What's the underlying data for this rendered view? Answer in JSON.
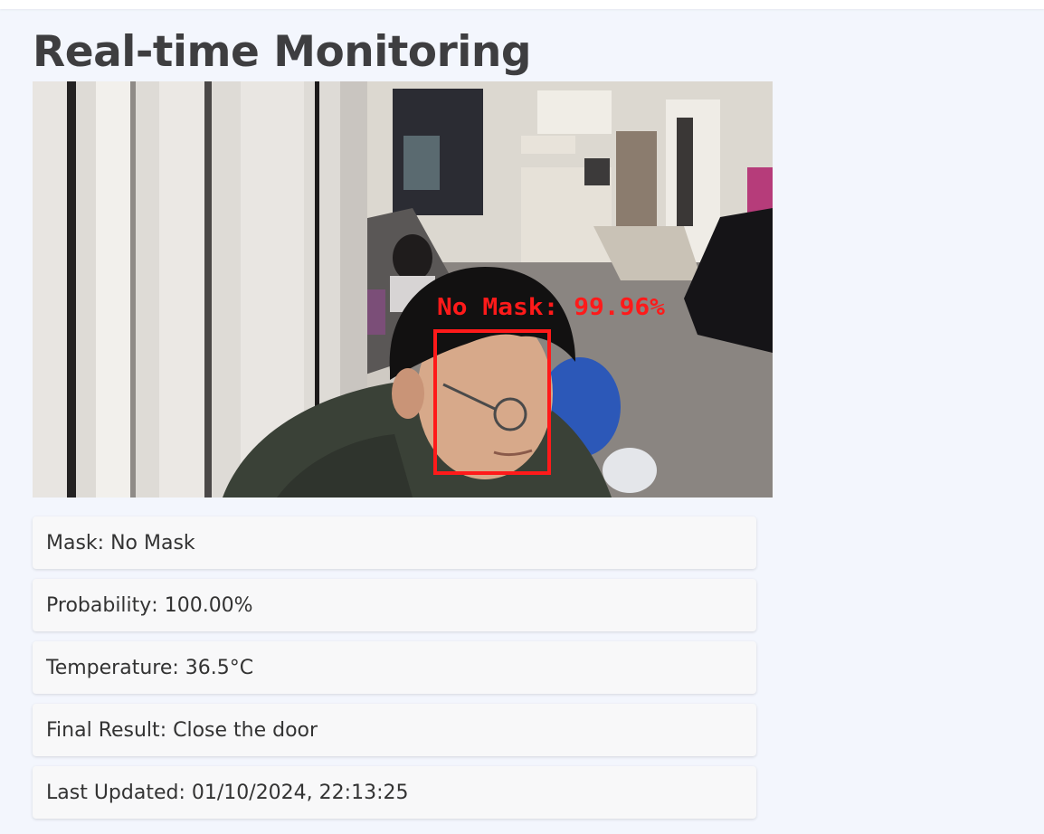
{
  "page": {
    "title": "Real-time Monitoring"
  },
  "camera": {
    "overlay_label": "No Mask: 99.96%",
    "overlay_color": "#ff1a1a"
  },
  "status": {
    "mask_label": "Mask",
    "mask_value": "No Mask",
    "probability_label": "Probability",
    "probability_value": "100.00%",
    "temperature_label": "Temperature",
    "temperature_value": "36.5°C",
    "final_result_label": "Final Result",
    "final_result_value": "Close the door",
    "last_updated_label": "Last Updated",
    "last_updated_value": "01/10/2024, 22:13:25"
  }
}
